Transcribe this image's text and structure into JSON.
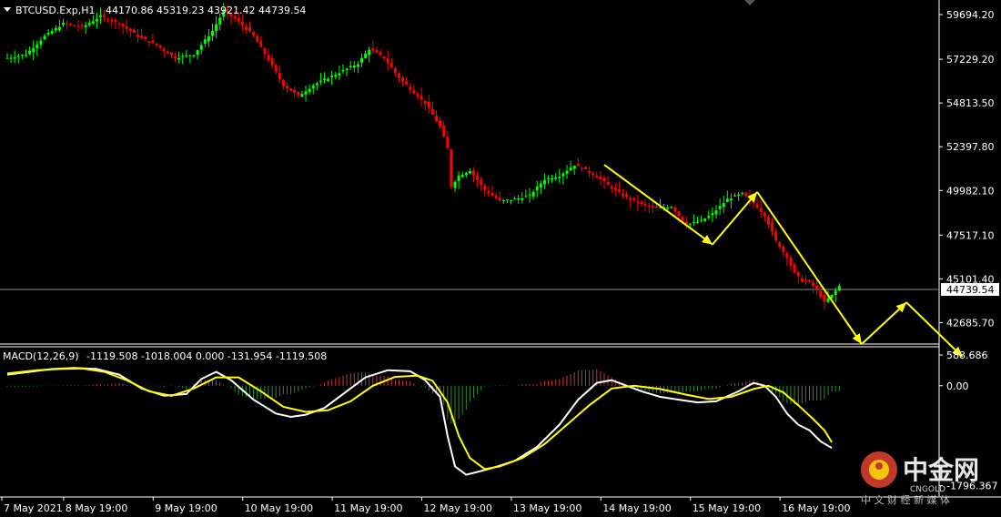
{
  "main_header": {
    "symbol_timeframe": "BTCUSD.Exp,H1",
    "ohlc": "44170.86 45319.23 43921.42 44739.54"
  },
  "price_axis_ticks": [
    "59694.20",
    "57229.20",
    "54813.50",
    "52397.80",
    "49982.10",
    "47517.10",
    "45101.40",
    "42685.70"
  ],
  "current_price_tag": "44739.54",
  "macd_header": {
    "name": "MACD(12,26,9)",
    "values": "-1119.508 -1018.004 0.000 -131.954 -1119.508"
  },
  "macd_axis_ticks": [
    "588.686",
    "0.00",
    "-1796.367"
  ],
  "time_axis_labels": [
    "7 May 2021",
    "8 May 19:00",
    "9 May 19:00",
    "10 May 19:00",
    "11 May 19:00",
    "12 May 19:00",
    "13 May 19:00",
    "14 May 19:00",
    "15 May 19:00",
    "16 May 19:00"
  ],
  "watermark": {
    "brand": "中金网",
    "sub": "中 文 财 经 新 媒 体",
    "domain": "CNGOLD"
  },
  "colors": {
    "bull": "#00ff00",
    "bear": "#ff0000",
    "macd_line": "#ffffff",
    "signal_line": "#ffff00",
    "arrow": "#ffff00",
    "hist_pos": "#cc3333",
    "hist_neg": "#2e8b2e",
    "axis": "#ffffff"
  },
  "chart_data": {
    "type": "line",
    "price_panel": {
      "y_axis_range": [
        41500,
        60500
      ],
      "current_price": 44739.54,
      "price_path": [
        [
          0,
          57300
        ],
        [
          5,
          57500
        ],
        [
          10,
          58500
        ],
        [
          15,
          59200
        ],
        [
          20,
          59000
        ],
        [
          25,
          59600
        ],
        [
          30,
          59200
        ],
        [
          35,
          58500
        ],
        [
          40,
          58000
        ],
        [
          45,
          57300
        ],
        [
          50,
          57500
        ],
        [
          55,
          58800
        ],
        [
          58,
          59900
        ],
        [
          62,
          59300
        ],
        [
          66,
          58500
        ],
        [
          70,
          57200
        ],
        [
          74,
          55800
        ],
        [
          78,
          55200
        ],
        [
          82,
          55800
        ],
        [
          86,
          56200
        ],
        [
          90,
          56600
        ],
        [
          94,
          57000
        ],
        [
          97,
          57800
        ],
        [
          101,
          57300
        ],
        [
          105,
          56200
        ],
        [
          109,
          55400
        ],
        [
          112,
          54800
        ],
        [
          116,
          53500
        ],
        [
          118,
          52300
        ],
        [
          119,
          50200
        ],
        [
          121,
          50800
        ],
        [
          124,
          51100
        ],
        [
          128,
          50000
        ],
        [
          132,
          49400
        ],
        [
          136,
          49500
        ],
        [
          140,
          49700
        ],
        [
          144,
          50600
        ],
        [
          148,
          50800
        ],
        [
          152,
          51400
        ],
        [
          156,
          51000
        ],
        [
          159,
          50600
        ],
        [
          162,
          50100
        ],
        [
          166,
          49600
        ],
        [
          170,
          49200
        ],
        [
          174,
          49000
        ],
        [
          178,
          49100
        ],
        [
          182,
          48100
        ],
        [
          186,
          48300
        ],
        [
          189,
          48700
        ],
        [
          193,
          49500
        ],
        [
          197,
          49800
        ],
        [
          200,
          49300
        ],
        [
          203,
          48600
        ],
        [
          206,
          47200
        ],
        [
          209,
          46300
        ],
        [
          211,
          45400
        ],
        [
          213,
          45000
        ],
        [
          215,
          44900
        ],
        [
          217,
          44500
        ],
        [
          219,
          43800
        ],
        [
          221,
          44200
        ],
        [
          223,
          44700
        ]
      ],
      "trend_arrows": [
        {
          "from": [
            160,
            51400
          ],
          "to": [
            189,
            47000
          ]
        },
        {
          "from": [
            189,
            47000
          ],
          "to": [
            201,
            49900
          ]
        },
        {
          "from": [
            201,
            49900
          ],
          "to": [
            229,
            41500
          ]
        },
        {
          "from": [
            229,
            41500
          ],
          "to": [
            241,
            43800
          ]
        },
        {
          "from": [
            241,
            43800
          ],
          "to": [
            256,
            40800
          ]
        }
      ]
    },
    "macd_panel": {
      "y_axis_range": [
        -2000,
        700
      ],
      "macd_line": [
        [
          0,
          200
        ],
        [
          6,
          250
        ],
        [
          12,
          300
        ],
        [
          18,
          320
        ],
        [
          24,
          300
        ],
        [
          30,
          200
        ],
        [
          36,
          -50
        ],
        [
          42,
          -180
        ],
        [
          48,
          -150
        ],
        [
          52,
          120
        ],
        [
          56,
          250
        ],
        [
          60,
          100
        ],
        [
          66,
          -250
        ],
        [
          72,
          -500
        ],
        [
          76,
          -560
        ],
        [
          80,
          -520
        ],
        [
          85,
          -400
        ],
        [
          90,
          -150
        ],
        [
          96,
          150
        ],
        [
          102,
          280
        ],
        [
          108,
          260
        ],
        [
          112,
          100
        ],
        [
          116,
          -200
        ],
        [
          118,
          -900
        ],
        [
          120,
          -1450
        ],
        [
          123,
          -1600
        ],
        [
          126,
          -1550
        ],
        [
          130,
          -1480
        ],
        [
          136,
          -1350
        ],
        [
          142,
          -1100
        ],
        [
          148,
          -700
        ],
        [
          153,
          -250
        ],
        [
          158,
          50
        ],
        [
          162,
          100
        ],
        [
          166,
          0
        ],
        [
          170,
          -100
        ],
        [
          175,
          -200
        ],
        [
          180,
          -250
        ],
        [
          185,
          -300
        ],
        [
          190,
          -280
        ],
        [
          196,
          -100
        ],
        [
          200,
          50
        ],
        [
          203,
          0
        ],
        [
          206,
          -200
        ],
        [
          209,
          -500
        ],
        [
          212,
          -700
        ],
        [
          215,
          -800
        ],
        [
          218,
          -1000
        ],
        [
          221,
          -1120
        ]
      ],
      "signal_line": [
        [
          0,
          220
        ],
        [
          8,
          280
        ],
        [
          14,
          300
        ],
        [
          20,
          310
        ],
        [
          26,
          250
        ],
        [
          32,
          100
        ],
        [
          38,
          -100
        ],
        [
          44,
          -180
        ],
        [
          50,
          -50
        ],
        [
          56,
          150
        ],
        [
          62,
          150
        ],
        [
          68,
          -100
        ],
        [
          74,
          -380
        ],
        [
          80,
          -470
        ],
        [
          86,
          -440
        ],
        [
          92,
          -280
        ],
        [
          98,
          0
        ],
        [
          104,
          160
        ],
        [
          110,
          180
        ],
        [
          114,
          90
        ],
        [
          118,
          -300
        ],
        [
          121,
          -900
        ],
        [
          124,
          -1300
        ],
        [
          128,
          -1500
        ],
        [
          132,
          -1450
        ],
        [
          138,
          -1300
        ],
        [
          144,
          -1050
        ],
        [
          150,
          -700
        ],
        [
          156,
          -350
        ],
        [
          162,
          -50
        ],
        [
          168,
          0
        ],
        [
          175,
          -60
        ],
        [
          182,
          -160
        ],
        [
          188,
          -240
        ],
        [
          194,
          -200
        ],
        [
          200,
          -60
        ],
        [
          204,
          0
        ],
        [
          208,
          -120
        ],
        [
          212,
          -350
        ],
        [
          216,
          -600
        ],
        [
          219,
          -800
        ],
        [
          221,
          -1018
        ]
      ]
    }
  }
}
